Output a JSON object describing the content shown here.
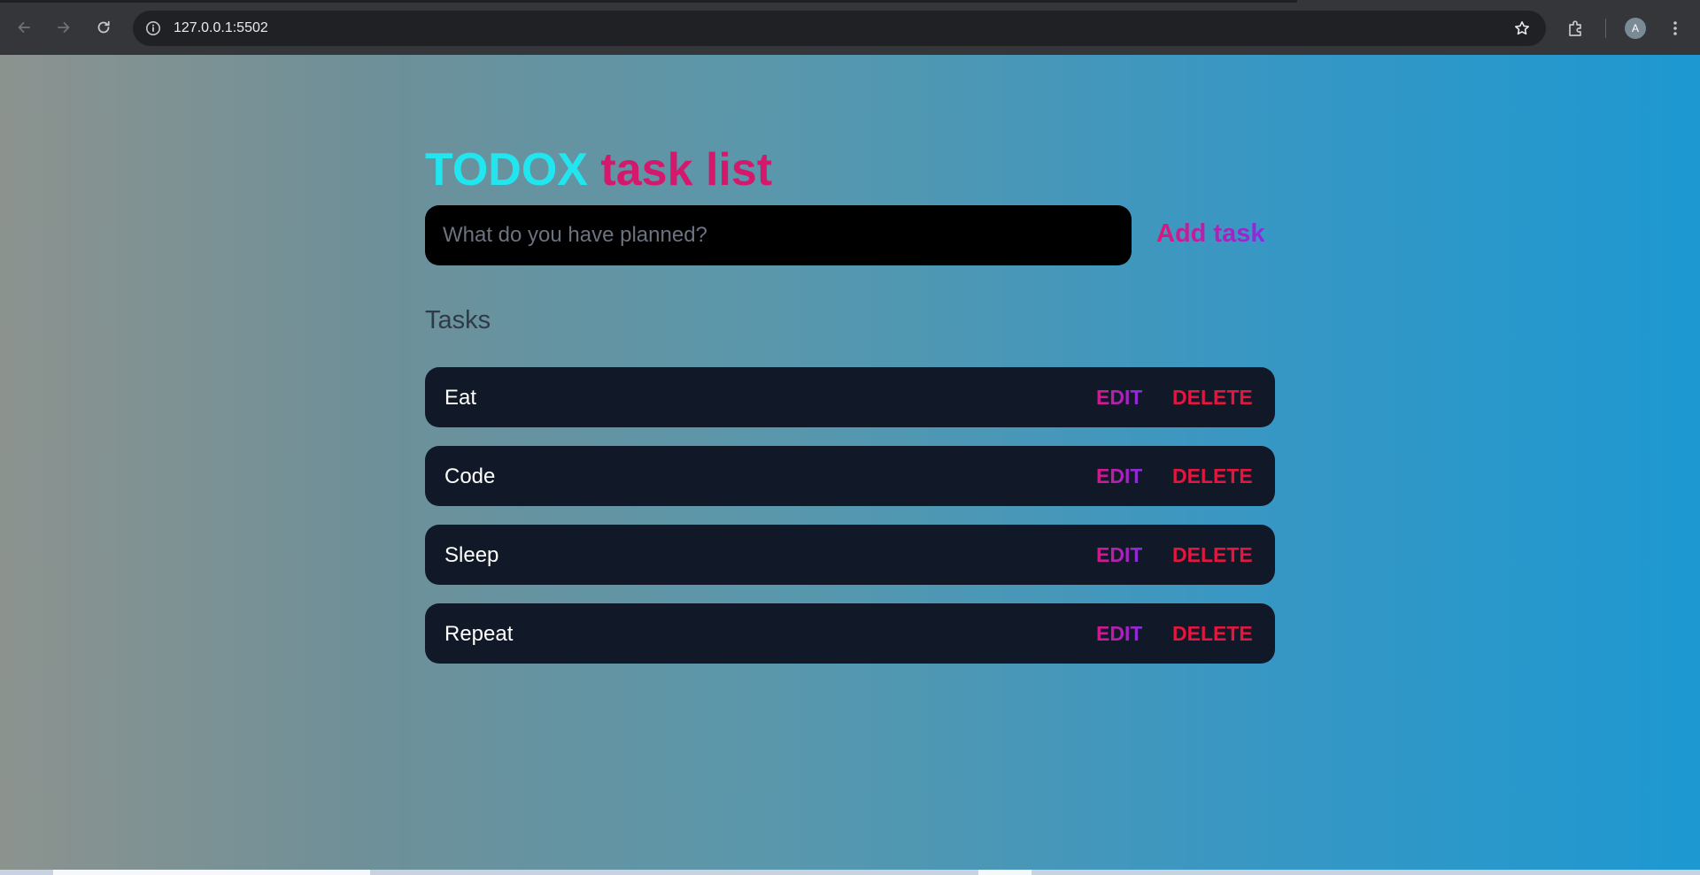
{
  "browser": {
    "url": "127.0.0.1:5502",
    "avatar_letter": "A",
    "icons": [
      "back-arrow-icon",
      "forward-arrow-icon",
      "reload-icon",
      "site-info-icon",
      "bookmark-star-icon",
      "extensions-puzzle-icon",
      "kebab-menu-icon"
    ]
  },
  "app": {
    "title_brand": "TODOX",
    "title_rest": "task list",
    "input_placeholder": "What do you have planned?",
    "input_value": "",
    "add_label": "Add task",
    "tasks_heading": "Tasks",
    "edit_label": "EDIT",
    "delete_label": "DELETE",
    "tasks": [
      {
        "text": "Eat"
      },
      {
        "text": "Code"
      },
      {
        "text": "Sleep"
      },
      {
        "text": "Repeat"
      }
    ],
    "colors": {
      "brand": "#21e6f0",
      "title_accent": "#d4196c",
      "delete": "#e1173f",
      "task_bg": "#111827",
      "input_bg": "#000000"
    }
  }
}
